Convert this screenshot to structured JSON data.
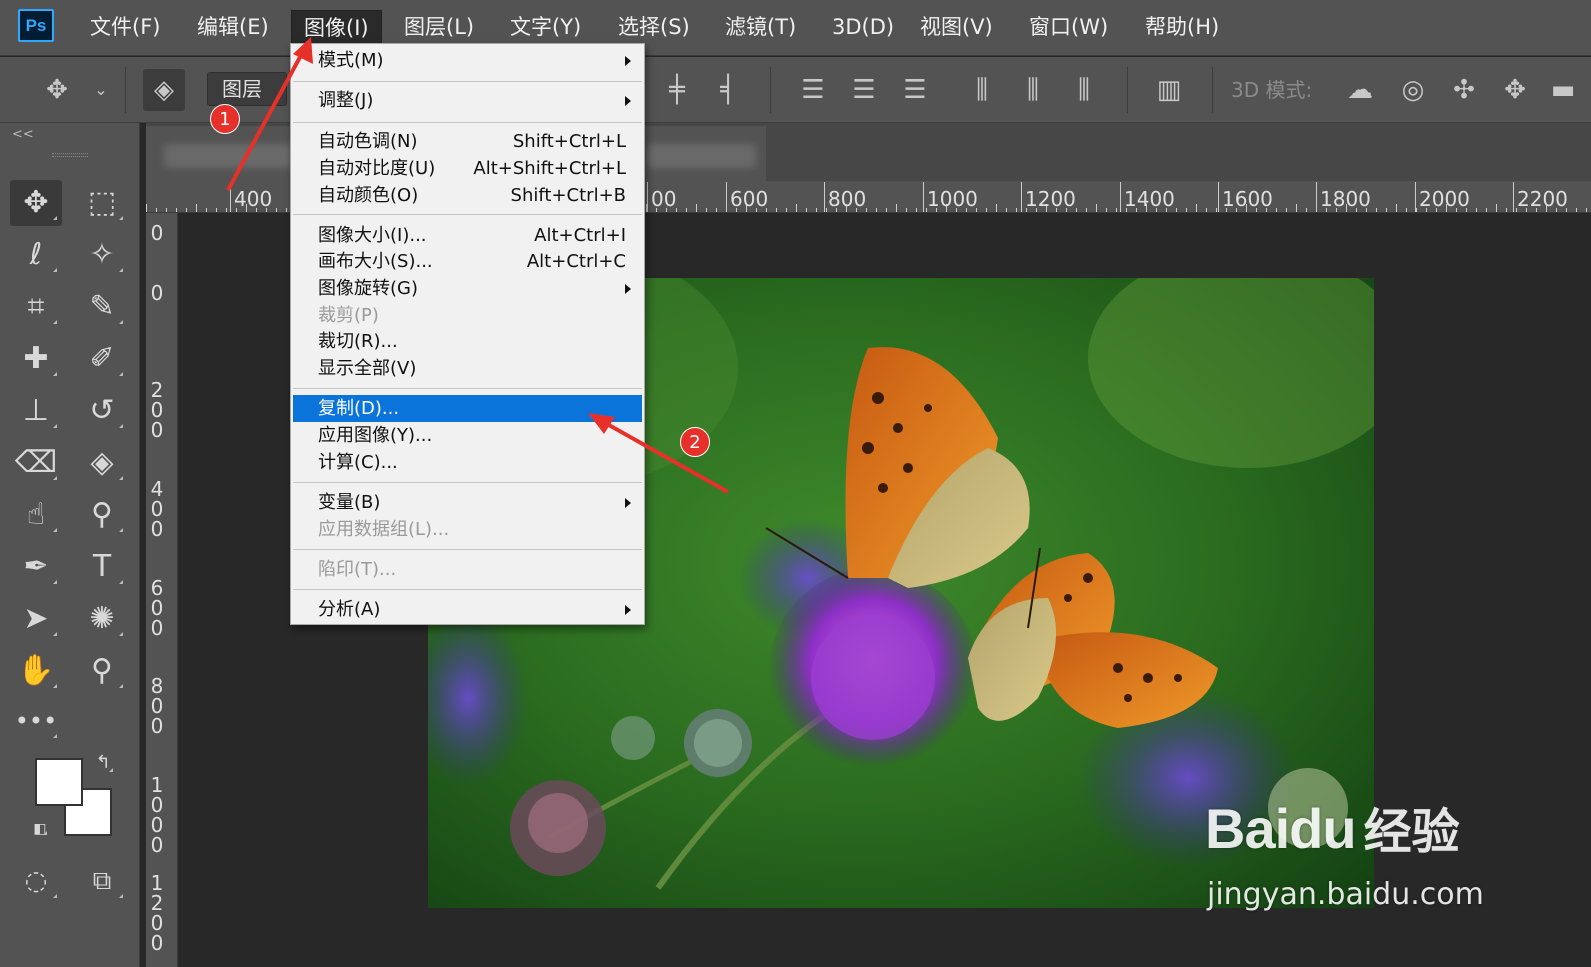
{
  "app": {
    "logo": "Ps"
  },
  "menubar": {
    "items": [
      {
        "label": "文件(F)"
      },
      {
        "label": "编辑(E)"
      },
      {
        "label": "图像(I)"
      },
      {
        "label": "图层(L)"
      },
      {
        "label": "文字(Y)"
      },
      {
        "label": "选择(S)"
      },
      {
        "label": "滤镜(T)"
      },
      {
        "label": "3D(D)"
      },
      {
        "label": "视图(V)"
      },
      {
        "label": "窗口(W)"
      },
      {
        "label": "帮助(H)"
      }
    ],
    "active_index": 2
  },
  "options_bar": {
    "layer_select_value": "图层",
    "mode_3d_label": "3D 模式:"
  },
  "image_menu": {
    "items": [
      {
        "label": "模式(M)",
        "shortcut": "",
        "submenu": true,
        "disabled": false,
        "highlighted": false
      },
      {
        "label": "调整(J)",
        "shortcut": "",
        "submenu": true,
        "disabled": false,
        "highlighted": false
      },
      {
        "label": "自动色调(N)",
        "shortcut": "Shift+Ctrl+L",
        "submenu": false,
        "disabled": false,
        "highlighted": false
      },
      {
        "label": "自动对比度(U)",
        "shortcut": "Alt+Shift+Ctrl+L",
        "submenu": false,
        "disabled": false,
        "highlighted": false
      },
      {
        "label": "自动颜色(O)",
        "shortcut": "Shift+Ctrl+B",
        "submenu": false,
        "disabled": false,
        "highlighted": false
      },
      {
        "label": "图像大小(I)...",
        "shortcut": "Alt+Ctrl+I",
        "submenu": false,
        "disabled": false,
        "highlighted": false
      },
      {
        "label": "画布大小(S)...",
        "shortcut": "Alt+Ctrl+C",
        "submenu": false,
        "disabled": false,
        "highlighted": false
      },
      {
        "label": "图像旋转(G)",
        "shortcut": "",
        "submenu": true,
        "disabled": false,
        "highlighted": false
      },
      {
        "label": "裁剪(P)",
        "shortcut": "",
        "submenu": false,
        "disabled": true,
        "highlighted": false
      },
      {
        "label": "裁切(R)...",
        "shortcut": "",
        "submenu": false,
        "disabled": false,
        "highlighted": false
      },
      {
        "label": "显示全部(V)",
        "shortcut": "",
        "submenu": false,
        "disabled": false,
        "highlighted": false
      },
      {
        "label": "复制(D)...",
        "shortcut": "",
        "submenu": false,
        "disabled": false,
        "highlighted": true
      },
      {
        "label": "应用图像(Y)...",
        "shortcut": "",
        "submenu": false,
        "disabled": false,
        "highlighted": false
      },
      {
        "label": "计算(C)...",
        "shortcut": "",
        "submenu": false,
        "disabled": false,
        "highlighted": false
      },
      {
        "label": "变量(B)",
        "shortcut": "",
        "submenu": true,
        "disabled": false,
        "highlighted": false
      },
      {
        "label": "应用数据组(L)...",
        "shortcut": "",
        "submenu": false,
        "disabled": true,
        "highlighted": false
      },
      {
        "label": "陷印(T)...",
        "shortcut": "",
        "submenu": false,
        "disabled": true,
        "highlighted": false
      },
      {
        "label": "分析(A)",
        "shortcut": "",
        "submenu": true,
        "disabled": false,
        "highlighted": false
      }
    ]
  },
  "ruler_horizontal": {
    "labels": [
      "400",
      "00",
      "600",
      "800",
      "1000",
      "1200",
      "1400",
      "1600",
      "1800",
      "2000",
      "2200"
    ]
  },
  "ruler_vertical": {
    "labels": [
      "0",
      "0",
      "200",
      "400",
      "600",
      "800",
      "1000",
      "1200"
    ]
  },
  "annotations": [
    {
      "label": "1"
    },
    {
      "label": "2"
    }
  ],
  "watermark": {
    "brand": "Baidu",
    "name_cn": "经验",
    "url": "jingyan.baidu.com"
  },
  "icons": {
    "move": "move-tool-icon",
    "marquee": "rect-marquee-icon",
    "lasso": "lasso-icon",
    "magic": "magic-wand-icon",
    "crop": "crop-icon",
    "eyedropper": "eyedropper-icon",
    "heal": "healing-brush-icon",
    "brush": "brush-icon",
    "stamp": "clone-stamp-icon",
    "history": "history-brush-icon",
    "eraser": "eraser-icon",
    "bucket": "paint-bucket-icon",
    "smudge": "smudge-icon",
    "dodge": "dodge-icon",
    "pen": "pen-icon",
    "type": "type-icon",
    "select": "path-select-icon",
    "shape": "custom-shape-icon",
    "hand": "hand-icon",
    "zoom": "zoom-icon"
  },
  "colors": {
    "highlight": "#0a74da",
    "badge": "#e8302a",
    "ps_accent": "#31a8ff"
  }
}
